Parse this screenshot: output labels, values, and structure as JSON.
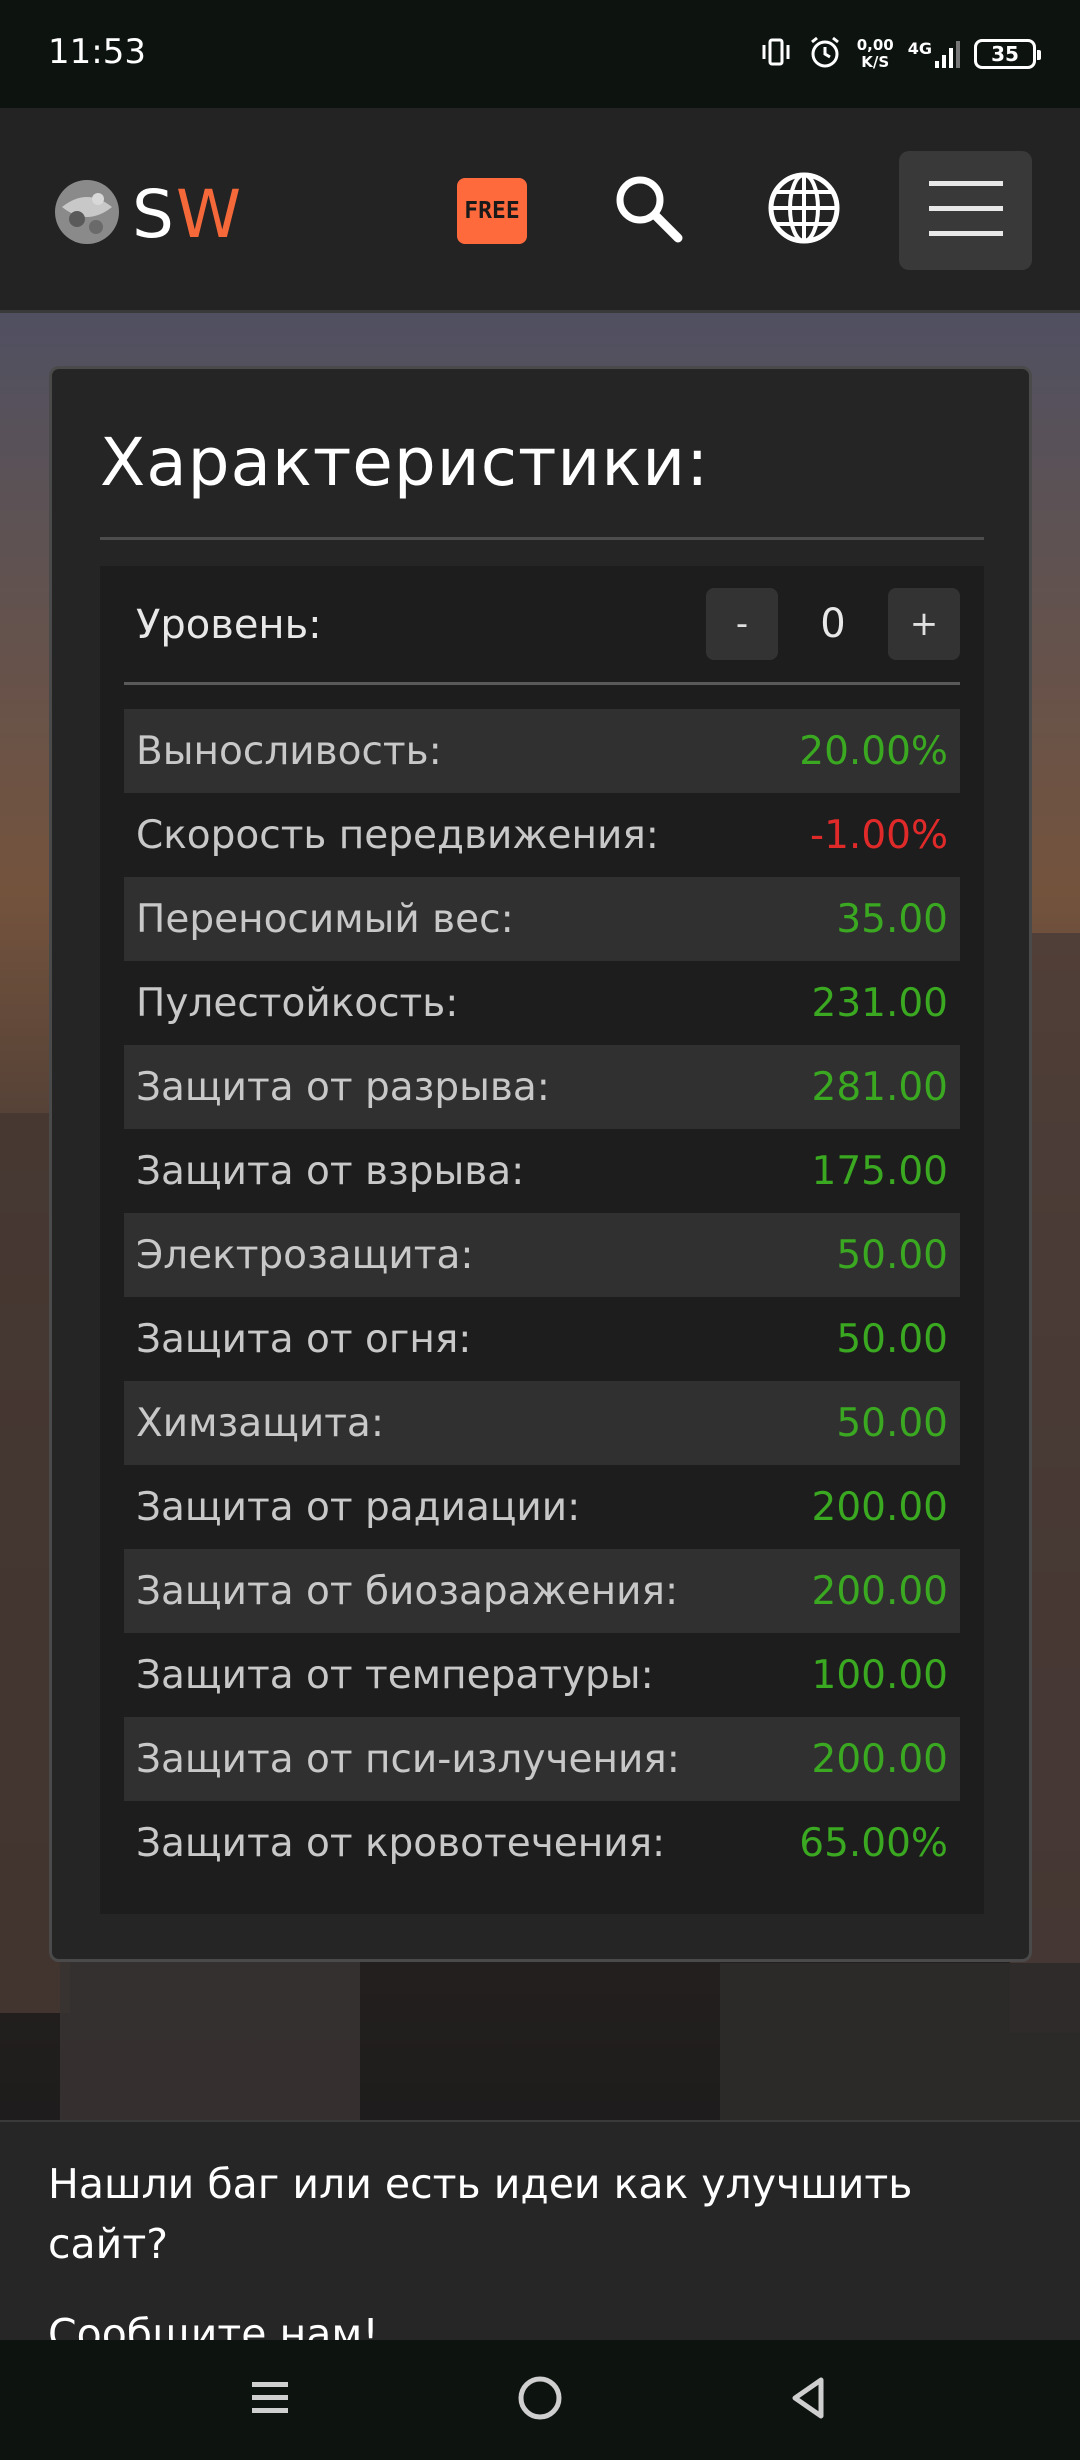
{
  "status_bar": {
    "time": "11:53",
    "speed_value": "0,00",
    "speed_unit": "K/S",
    "network": "4G",
    "battery": "35"
  },
  "header": {
    "logo_s": "S",
    "logo_w": "W",
    "free_badge": "FREE",
    "icons": [
      "search-icon",
      "globe-icon",
      "hamburger-menu-icon"
    ],
    "accent_color": "#ff6a3d"
  },
  "card": {
    "title": "Характеристики:",
    "level": {
      "label": "Уровень:",
      "minus": "-",
      "value": "0",
      "plus": "+"
    },
    "stats": [
      {
        "label": "Выносливость:",
        "value": "20.00%",
        "color": "#3aa820"
      },
      {
        "label": "Скорость передвижения:",
        "value": "-1.00%",
        "color": "#e02a2a"
      },
      {
        "label": "Переносимый вес:",
        "value": "35.00",
        "color": "#3aa820"
      },
      {
        "label": "Пулестойкость:",
        "value": "231.00",
        "color": "#3aa820"
      },
      {
        "label": "Защита от разрыва:",
        "value": "281.00",
        "color": "#3aa820"
      },
      {
        "label": "Защита от взрыва:",
        "value": "175.00",
        "color": "#3aa820"
      },
      {
        "label": "Электрозащита:",
        "value": "50.00",
        "color": "#3aa820"
      },
      {
        "label": "Защита от огня:",
        "value": "50.00",
        "color": "#3aa820"
      },
      {
        "label": "Химзащита:",
        "value": "50.00",
        "color": "#3aa820"
      },
      {
        "label": "Защита от радиации:",
        "value": "200.00",
        "color": "#3aa820"
      },
      {
        "label": "Защита от биозаражения:",
        "value": "200.00",
        "color": "#3aa820"
      },
      {
        "label": "Защита от температуры:",
        "value": "100.00",
        "color": "#3aa820"
      },
      {
        "label": "Защита от пси-излучения:",
        "value": "200.00",
        "color": "#3aa820"
      },
      {
        "label": "Защита от кровотечения:",
        "value": "65.00%",
        "color": "#3aa820"
      }
    ]
  },
  "footer": {
    "text": "Нашли баг или есть идеи как улучшить сайт?",
    "text2": "Сообщите нам!"
  },
  "nav_bar": {
    "icons": [
      "recent-apps-icon",
      "home-icon",
      "back-icon"
    ]
  }
}
